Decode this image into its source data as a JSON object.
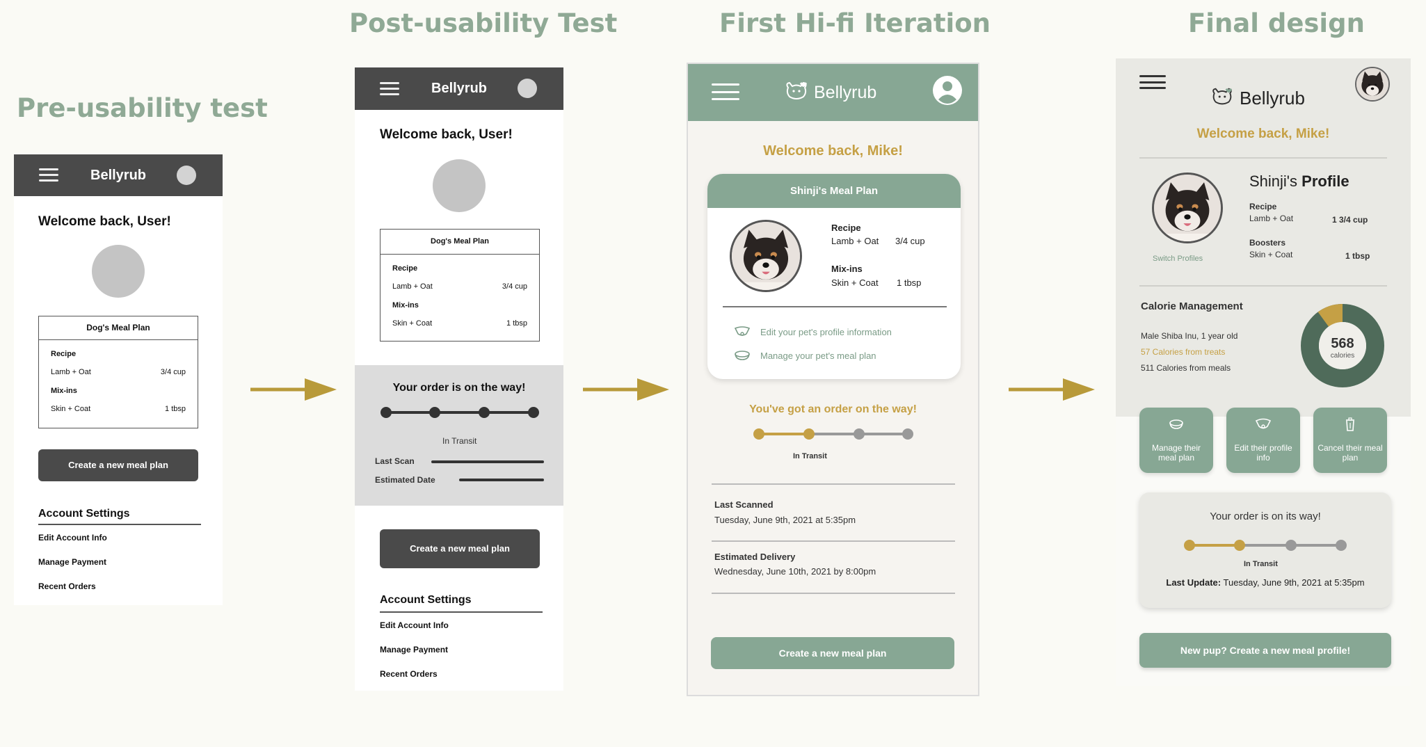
{
  "stage_titles": {
    "pre": "Pre-usability test",
    "post": "Post-usability Test",
    "hifi": "First Hi-fi Iteration",
    "final": "Final design"
  },
  "colors": {
    "sage": "#87a794",
    "title_sage": "#8fa995",
    "gold": "#c5a045",
    "dark_grey": "#4a4a4a",
    "arrow": "#b89a3a"
  },
  "pre_usability": {
    "app_name": "Bellyrub",
    "welcome": "Welcome back, User!",
    "plan": {
      "title": "Dog's Meal Plan",
      "recipe_label": "Recipe",
      "recipe_item": "Lamb + Oat",
      "recipe_qty": "3/4 cup",
      "mixins_label": "Mix-ins",
      "mixin_item": "Skin + Coat",
      "mixin_qty": "1 tbsp"
    },
    "cta": "Create a new meal plan",
    "account": {
      "heading": "Account Settings",
      "items": [
        "Edit Account Info",
        "Manage Payment",
        "Recent Orders"
      ]
    }
  },
  "post_usability": {
    "app_name": "Bellyrub",
    "welcome": "Welcome back, User!",
    "plan": {
      "title": "Dog's Meal Plan",
      "recipe_label": "Recipe",
      "recipe_item": "Lamb + Oat",
      "recipe_qty": "3/4 cup",
      "mixins_label": "Mix-ins",
      "mixin_item": "Skin + Coat",
      "mixin_qty": "1 tbsp"
    },
    "order": {
      "title": "Your order is on the way!",
      "status": "In Transit",
      "last_scan_label": "Last Scan",
      "est_date_label": "Estimated Date",
      "steps_total": 4
    },
    "cta": "Create a new meal plan",
    "account": {
      "heading": "Account Settings",
      "items": [
        "Edit Account Info",
        "Manage Payment",
        "Recent Orders"
      ]
    }
  },
  "hifi": {
    "app_name": "Bellyrub",
    "welcome": "Welcome back, Mike!",
    "card": {
      "title": "Shinji's Meal Plan",
      "recipe_label": "Recipe",
      "recipe_item": "Lamb + Oat",
      "recipe_qty": "3/4 cup",
      "mixins_label": "Mix-ins",
      "mixin_item": "Skin + Coat",
      "mixin_qty": "1 tbsp",
      "link_edit": "Edit your pet's profile information",
      "link_manage": "Manage your pet's meal plan"
    },
    "order": {
      "title": "You've got an order on the way!",
      "status": "In Transit",
      "steps_total": 4,
      "steps_done": 2
    },
    "last_scanned_label": "Last Scanned",
    "last_scanned_value": "Tuesday, June 9th, 2021 at 5:35pm",
    "est_delivery_label": "Estimated Delivery",
    "est_delivery_value": "Wednesday, June 10th, 2021 by 8:00pm",
    "cta": "Create a new meal plan"
  },
  "final": {
    "app_name": "Bellyrub",
    "welcome": "Welcome back, Mike!",
    "profile": {
      "name": "Shinji's",
      "suffix": "Profile",
      "switch": "Switch Profiles",
      "recipe_label": "Recipe",
      "recipe_item": "Lamb + Oat",
      "recipe_qty": "1 3/4 cup",
      "boosters_label": "Boosters",
      "booster_item": "Skin + Coat",
      "booster_qty": "1 tbsp"
    },
    "calories": {
      "heading": "Calorie Management",
      "breed": "Male Shiba Inu, 1 year old",
      "treats": "57 Calories from treats",
      "meals": "511 Calories from meals",
      "total": "568",
      "unit": "calories",
      "treats_value": 57,
      "meals_value": 511
    },
    "actions": [
      {
        "label": "Manage their meal plan",
        "icon": "bowl-icon"
      },
      {
        "label": "Edit their profile info",
        "icon": "collar-icon"
      },
      {
        "label": "Cancel their meal plan",
        "icon": "trash-icon"
      }
    ],
    "order": {
      "title": "Your order is on its way!",
      "status": "In Transit",
      "last_update_label": "Last Update:",
      "last_update_value": "Tuesday, June 9th, 2021 at 5:35pm",
      "steps_total": 4,
      "steps_done": 2
    },
    "cta": "New pup? Create a new meal profile!"
  }
}
